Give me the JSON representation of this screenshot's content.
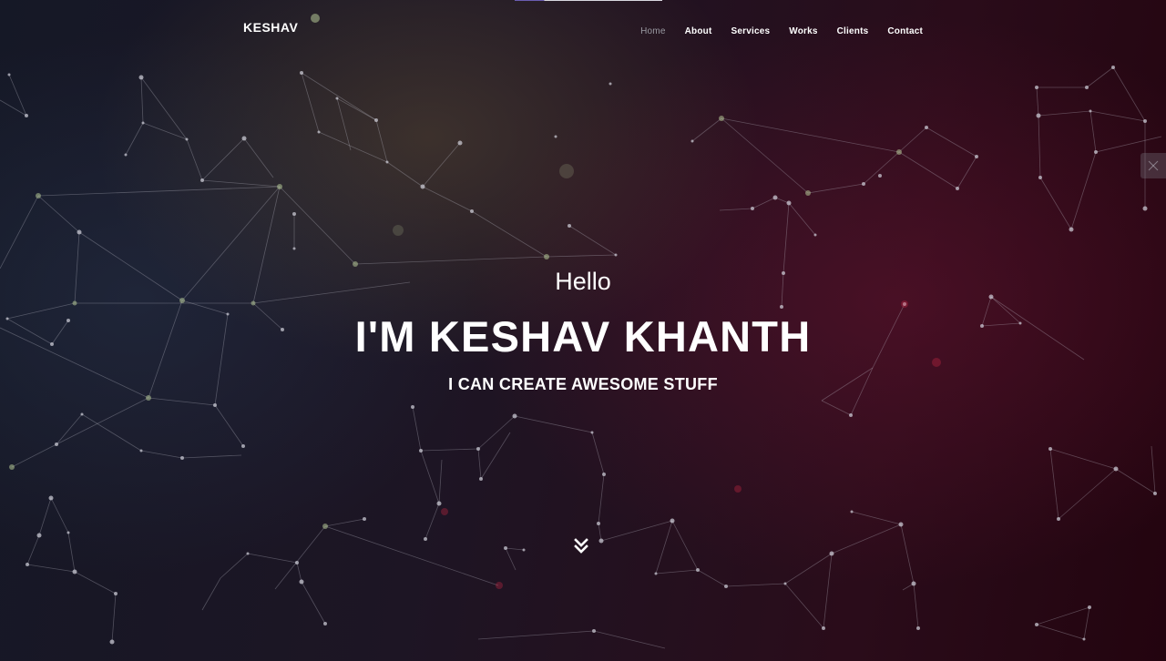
{
  "navbar": {
    "brand": "KESHAV",
    "links": [
      {
        "label": "Home",
        "active": true
      },
      {
        "label": "About"
      },
      {
        "label": "Services"
      },
      {
        "label": "Works"
      },
      {
        "label": "Clients"
      },
      {
        "label": "Contact"
      }
    ]
  },
  "hero": {
    "greeting": "Hello",
    "name": "I'M KESHAV KHANTH",
    "tagline": "I CAN CREATE AWESOME STUFF"
  },
  "icons": {
    "scroll": "double-chevron-down-icon",
    "side": "settings-icon"
  },
  "colors": {
    "text": "#ffffff",
    "nav_active": "#9a9aa2",
    "background_left": "#151826",
    "background_right": "#23040f"
  }
}
